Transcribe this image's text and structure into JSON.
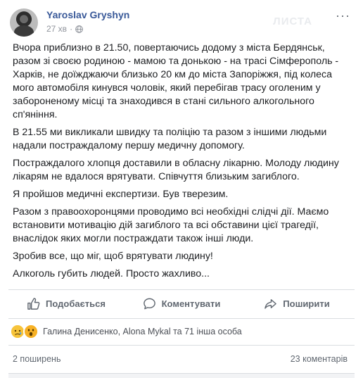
{
  "post": {
    "author": "Yaroslav Gryshyn",
    "time": "27 хв",
    "watermark": "ЛИСТА",
    "paragraphs": [
      "Вчора приблизно в 21.50, повертаючись додому з міста Бердянськ, разом зі своєю родиною - мамою та донькою - на трасі Сімферополь - Харків, не доїжджаючи близько 20 км до міста Запоріжжя, під колеса мого автомобіля кинувся чоловік, який перебігав трасу оголеним у забороненому місці та знаходився в стані сильного алкогольного сп'яніння.",
      "В 21.55 ми викликали швидку та поліцію та разом з іншими людьми надали постраждалому першу медичну допомогу.",
      "Постраждалого хлопця доставили в обласну лікарню. Молоду людину лікарям не вдалося врятувати. Співчуття близьким загиблого.",
      "Я пройшов медичні експертизи. Був тверезим.",
      "Разом з правоохоронцями проводимо всі необхідні слідчі дії. Маємо встановити мотивацію дій загиблого та всі обставини цієї трагедії, внаслідок яких могли постраждати також інші люди.",
      "Зробив все, що міг, щоб врятувати людину!",
      "Алкоголь губить людей. Просто жахливо..."
    ]
  },
  "actions": {
    "like": "Подобається",
    "comment": "Коментувати",
    "share": "Поширити"
  },
  "reactions": {
    "names": "Галина Денисенко, Alona Mykal та 71 інша особа",
    "types": [
      "sad-icon",
      "wow-icon"
    ]
  },
  "stats": {
    "shares": "2 поширень",
    "comments": "23 коментарів"
  },
  "colors": {
    "link": "#385898",
    "meta": "#90949c",
    "action": "#606770",
    "divider": "#dadde1"
  }
}
